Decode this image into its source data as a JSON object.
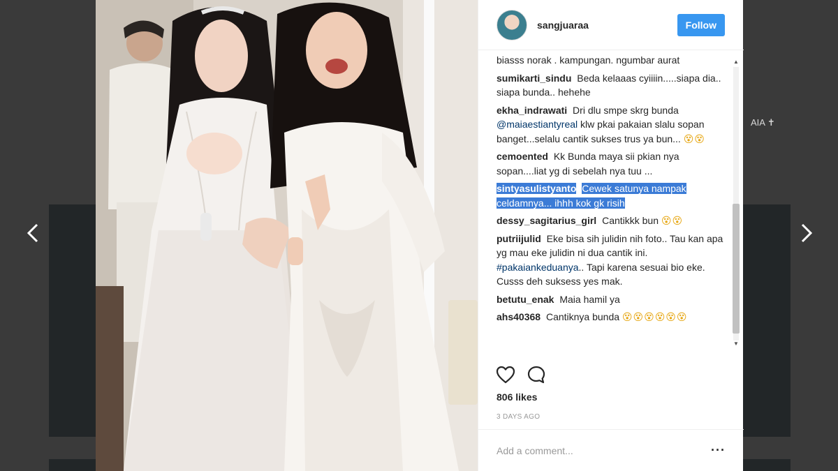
{
  "page": {
    "background_text": "AIA ✝"
  },
  "post": {
    "username": "sangjuaraa",
    "follow_label": "Follow",
    "likes": "806 likes",
    "time": "3 DAYS AGO",
    "comment_placeholder": "Add a comment...",
    "more_label": "···"
  },
  "comments": [
    {
      "user": "",
      "text": "biasss norak . kampungan. ngumbar aurat"
    },
    {
      "user": "sumikarti_sindu",
      "text": "Beda kelaaas cyiiiin.....siapa dia.. siapa bunda.. hehehe"
    },
    {
      "user": "ekha_indrawati",
      "text_a": "Dri dlu smpe skrg bunda",
      "mention": "@maiaestiantyreal",
      "text_b": "klw pkai pakaian slalu sopan banget...selalu cantik sukses trus ya bun...",
      "emoji": "😵😵"
    },
    {
      "user": "cemoented",
      "text": "Kk Bunda maya sii pkian nya sopan....liat yg di sebelah nya tuu ..."
    },
    {
      "user": "sintyasulistyanto",
      "text": "Cewek satunya nampak celdamnya... ihhh kok gk risih"
    },
    {
      "user": "dessy_sagitarius_girl",
      "text": "Cantikkk bun",
      "emoji": "😵😵"
    },
    {
      "user": "putriijulid",
      "text_a": "Eke bisa sih julidin nih foto.. Tau kan apa yg mau eke julidin ni dua cantik ini.",
      "tag": "#pakaiankeduanya",
      "text_b": ".. Tapi karena sesuai bio eke. Cusss deh suksess yes mak."
    },
    {
      "user": "betutu_enak",
      "text": "Maia hamil ya"
    },
    {
      "user": "ahs40368",
      "text": "Cantiknya bunda",
      "emoji": "😵😵😵😵😵😵"
    }
  ],
  "icons": {
    "heart": "heart-icon",
    "comment": "comment-icon",
    "prev": "chevron-left-icon",
    "next": "chevron-right-icon"
  },
  "colors": {
    "follow": "#3897f0",
    "highlight": "#3b7bd6",
    "mention": "#003569"
  }
}
